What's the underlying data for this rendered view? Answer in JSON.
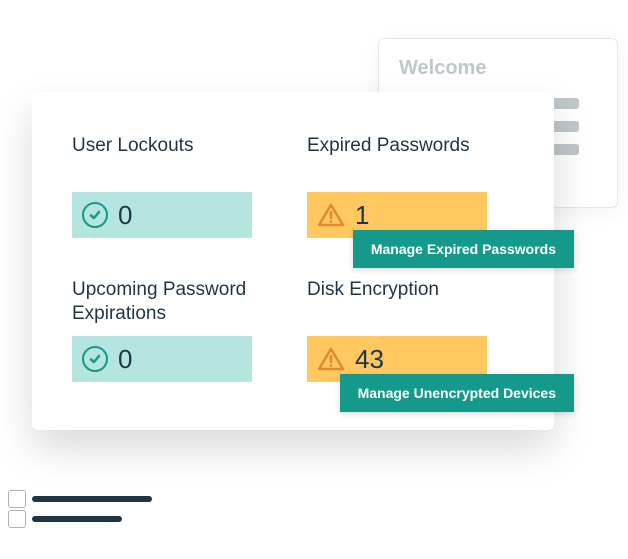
{
  "welcome": {
    "title": "Welcome"
  },
  "tiles": {
    "userLockouts": {
      "label": "User Lockouts",
      "value": "0",
      "status": "ok"
    },
    "expiredPasswords": {
      "label": "Expired Passwords",
      "value": "1",
      "status": "warn",
      "action": "Manage Expired Passwords"
    },
    "upcomingExpirations": {
      "label": "Upcoming Password Expirations",
      "value": "0",
      "status": "ok"
    },
    "diskEncryption": {
      "label": "Disk Encryption",
      "value": "43",
      "status": "warn",
      "action": "Manage Unencrypted Devices"
    }
  }
}
